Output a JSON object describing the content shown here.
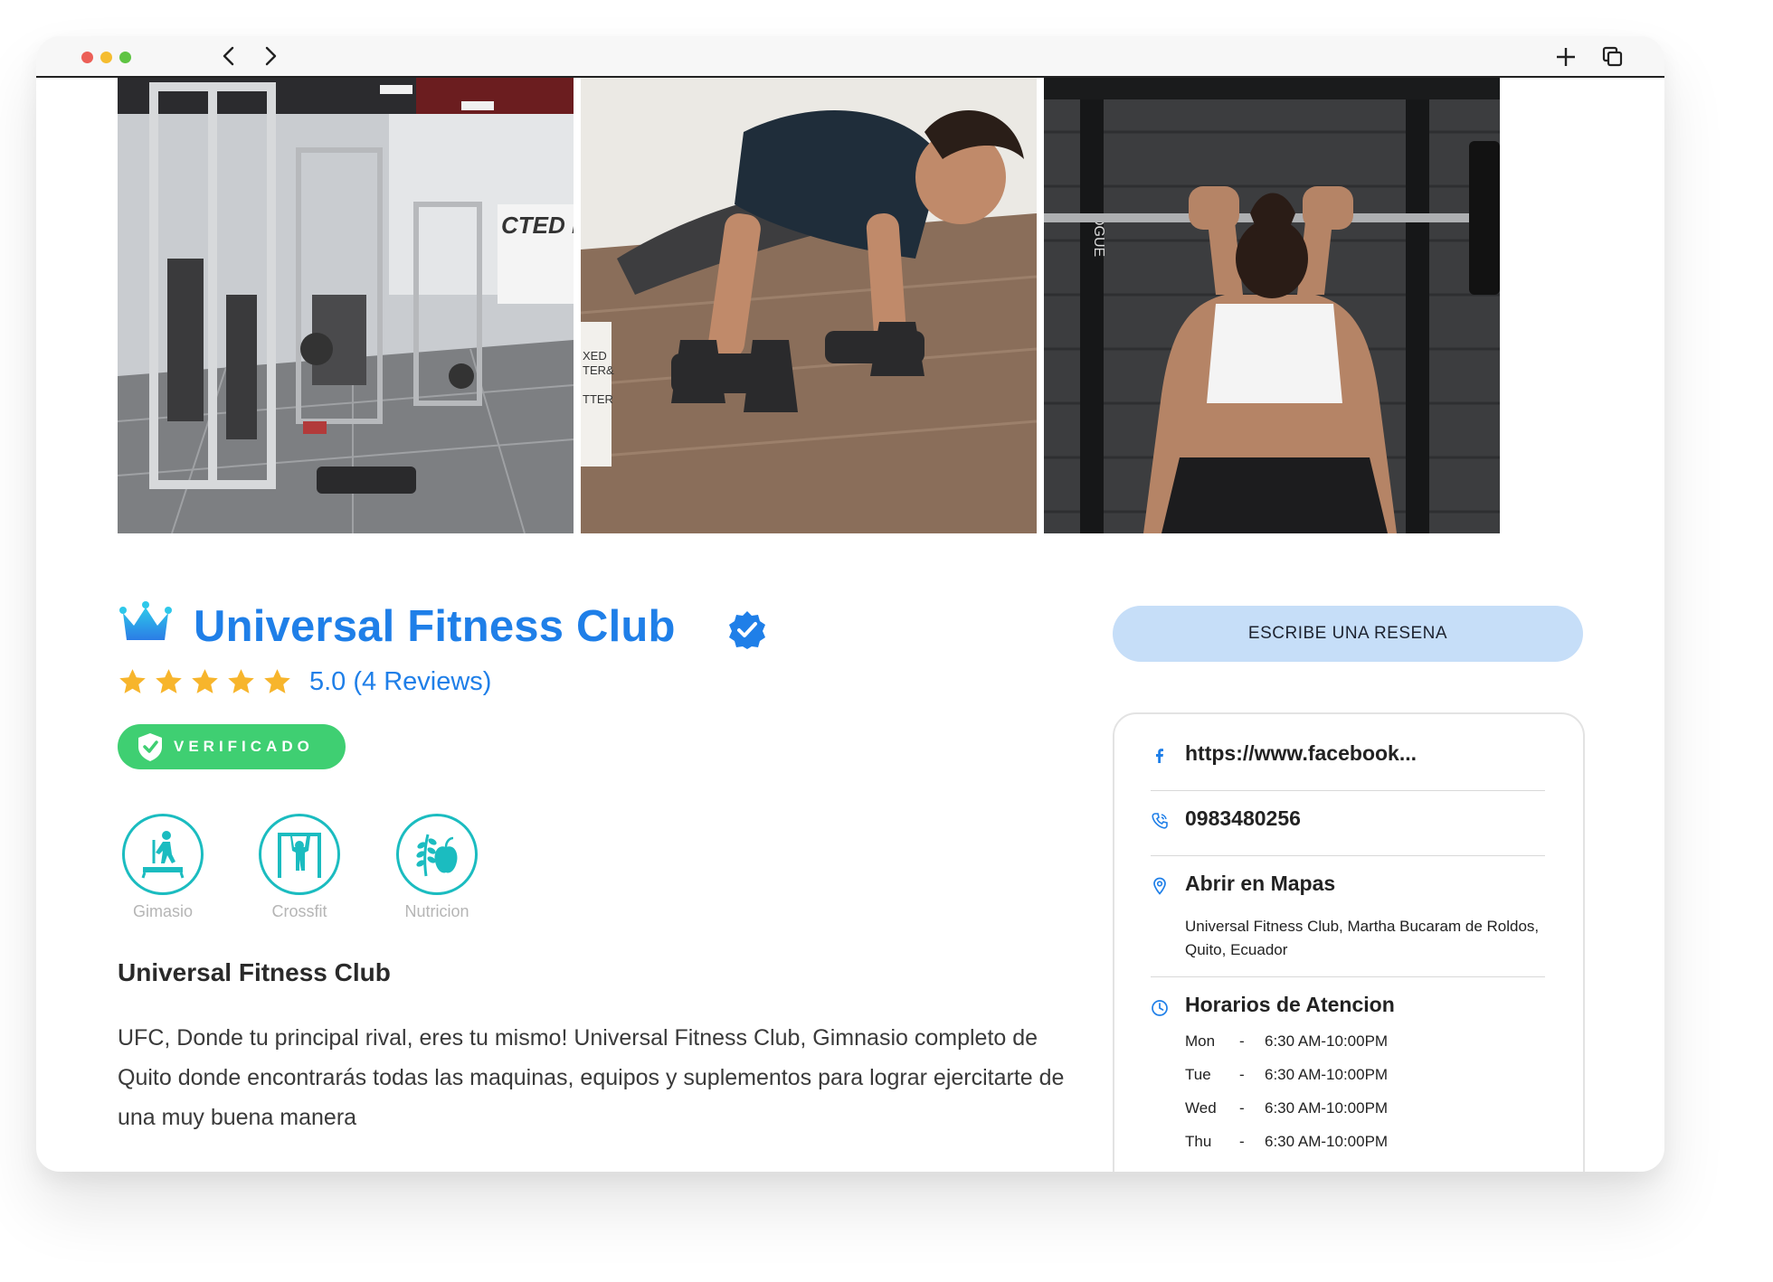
{
  "browser": {
    "traffic_lights": [
      "#ec5f57",
      "#f5bd30",
      "#5fc443"
    ]
  },
  "gallery": {
    "photos": [
      {
        "name": "gym-interior-photo",
        "label": "CTED FIT"
      },
      {
        "name": "pushup-dumbbell-photo",
        "label": "XED TER& TTER"
      },
      {
        "name": "barbell-squat-photo",
        "label": "DGUE"
      }
    ]
  },
  "header": {
    "title": "Universal Fitness Club",
    "rating_text": "5.0 (4 Reviews)",
    "star_count": 5,
    "verified_badge": "VERIFICADO"
  },
  "services": [
    {
      "label": "Gimasio",
      "icon": "treadmill-icon"
    },
    {
      "label": "Crossfit",
      "icon": "pullup-icon"
    },
    {
      "label": "Nutricion",
      "icon": "nutrition-icon"
    }
  ],
  "description": {
    "title": "Universal Fitness Club",
    "text": "UFC, Donde tu principal rival, eres tu mismo! Universal Fitness Club, Gimnasio completo de Quito donde encontrarás todas las maquinas, equipos y suplementos para lograr ejercitarte de una muy buena manera"
  },
  "sidebar": {
    "review_button": "ESCRIBE UNA RESENA",
    "facebook": "https://www.facebook...",
    "phone": "0983480256",
    "maps_label": "Abrir en Mapas",
    "address": "Universal Fitness Club, Martha Bucaram de Roldos, Quito, Ecuador",
    "hours_title": "Horarios de Atencion",
    "hours": [
      {
        "day": "Mon",
        "sep": "-",
        "time": "6:30 AM-10:00PM"
      },
      {
        "day": "Tue",
        "sep": "-",
        "time": "6:30 AM-10:00PM"
      },
      {
        "day": "Wed",
        "sep": "-",
        "time": "6:30 AM-10:00PM"
      },
      {
        "day": "Thu",
        "sep": "-",
        "time": "6:30 AM-10:00PM"
      }
    ]
  },
  "colors": {
    "accent_blue": "#1f7fe8",
    "verified_green": "#3fcf72",
    "service_teal": "#1bbcc0",
    "star_gold": "#f7b52c"
  }
}
